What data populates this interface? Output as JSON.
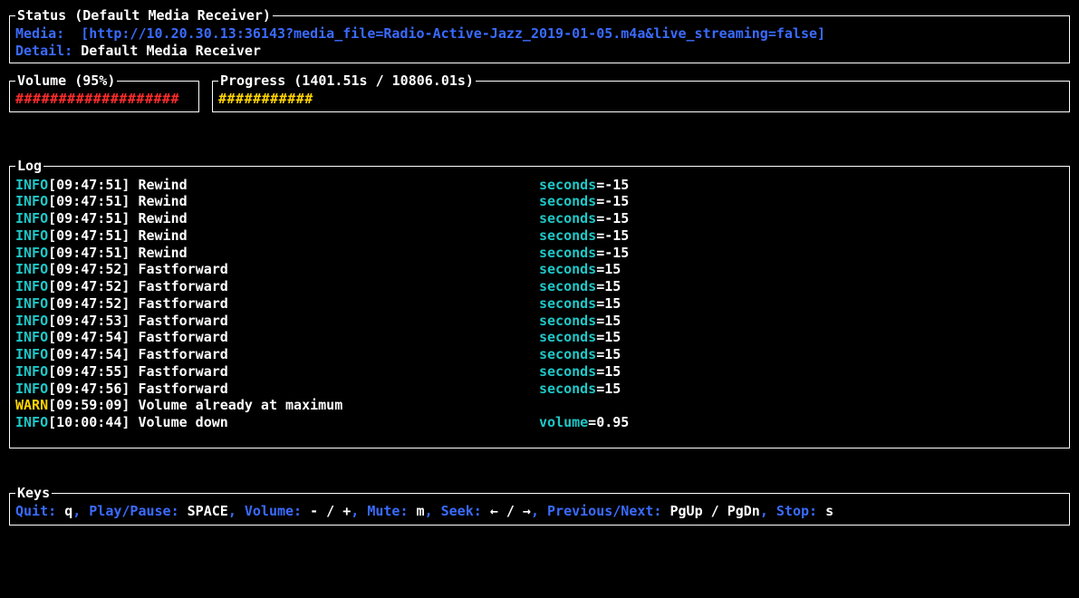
{
  "status": {
    "title": "Status (Default Media Receiver)",
    "media_label": "Media:  ",
    "media_value": "[http://10.20.30.13:36143?media_file=Radio-Active-Jazz_2019-01-05.m4a&live_streaming=false]",
    "detail_label": "Detail:",
    "detail_value": "Default Media Receiver"
  },
  "volume": {
    "title": "Volume (95%)",
    "bar": "###################"
  },
  "progress": {
    "title": "Progress (1401.51s / 10806.01s)",
    "bar": "###########"
  },
  "log": {
    "title": "Log",
    "entries": [
      {
        "level": "INFO",
        "time": "[09:47:51]",
        "msg": "Rewind",
        "param": "seconds",
        "val": "-15"
      },
      {
        "level": "INFO",
        "time": "[09:47:51]",
        "msg": "Rewind",
        "param": "seconds",
        "val": "-15"
      },
      {
        "level": "INFO",
        "time": "[09:47:51]",
        "msg": "Rewind",
        "param": "seconds",
        "val": "-15"
      },
      {
        "level": "INFO",
        "time": "[09:47:51]",
        "msg": "Rewind",
        "param": "seconds",
        "val": "-15"
      },
      {
        "level": "INFO",
        "time": "[09:47:51]",
        "msg": "Rewind",
        "param": "seconds",
        "val": "-15"
      },
      {
        "level": "INFO",
        "time": "[09:47:52]",
        "msg": "Fastforward",
        "param": "seconds",
        "val": "15"
      },
      {
        "level": "INFO",
        "time": "[09:47:52]",
        "msg": "Fastforward",
        "param": "seconds",
        "val": "15"
      },
      {
        "level": "INFO",
        "time": "[09:47:52]",
        "msg": "Fastforward",
        "param": "seconds",
        "val": "15"
      },
      {
        "level": "INFO",
        "time": "[09:47:53]",
        "msg": "Fastforward",
        "param": "seconds",
        "val": "15"
      },
      {
        "level": "INFO",
        "time": "[09:47:54]",
        "msg": "Fastforward",
        "param": "seconds",
        "val": "15"
      },
      {
        "level": "INFO",
        "time": "[09:47:54]",
        "msg": "Fastforward",
        "param": "seconds",
        "val": "15"
      },
      {
        "level": "INFO",
        "time": "[09:47:55]",
        "msg": "Fastforward",
        "param": "seconds",
        "val": "15"
      },
      {
        "level": "INFO",
        "time": "[09:47:56]",
        "msg": "Fastforward",
        "param": "seconds",
        "val": "15"
      },
      {
        "level": "WARN",
        "time": "[09:59:09]",
        "msg": "Volume already at maximum",
        "param": "",
        "val": ""
      },
      {
        "level": "INFO",
        "time": "[10:00:44]",
        "msg": "Volume down",
        "param": "volume",
        "val": "0.95"
      }
    ]
  },
  "keys": {
    "title": "Keys",
    "items": [
      {
        "label": "Quit",
        "key": "q"
      },
      {
        "label": "Play/Pause",
        "key": "SPACE"
      },
      {
        "label": "Volume",
        "key": "- / +"
      },
      {
        "label": "Mute",
        "key": "m"
      },
      {
        "label": "Seek",
        "key": "← / →"
      },
      {
        "label": "Previous/Next",
        "key": "PgUp / PgDn"
      },
      {
        "label": "Stop",
        "key": "s"
      }
    ]
  }
}
